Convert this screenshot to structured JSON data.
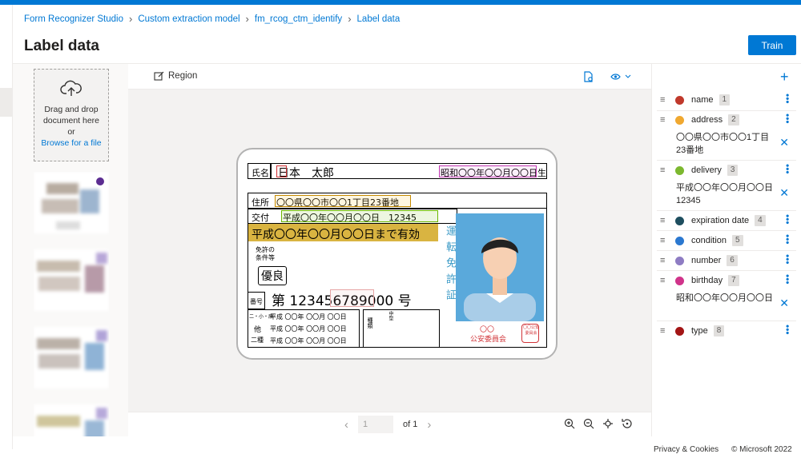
{
  "breadcrumb": [
    "Form Recognizer Studio",
    "Custom extraction model",
    "fm_rcog_ctm_identify",
    "Label data"
  ],
  "page_title": "Label data",
  "train_label": "Train",
  "upload": {
    "line1": "Drag and drop",
    "line2": "document here",
    "line3": "or",
    "browse": "Browse for a file"
  },
  "toolbar": {
    "region_label": "Region"
  },
  "pager": {
    "current": "1",
    "of_label": "of 1"
  },
  "footer": {
    "privacy": "Privacy & Cookies",
    "copyright": "© Microsoft 2022"
  },
  "fields": [
    {
      "name": "name",
      "index": "1",
      "color": "#c0392b",
      "value": ""
    },
    {
      "name": "address",
      "index": "2",
      "color": "#f0a830",
      "value": "〇〇県〇〇市〇〇1丁目23番地"
    },
    {
      "name": "delivery",
      "index": "3",
      "color": "#7cb82f",
      "value": "平成〇〇年〇〇月〇〇日12345"
    },
    {
      "name": "expiration date",
      "index": "4",
      "color": "#1e4e5f",
      "value": ""
    },
    {
      "name": "condition",
      "index": "5",
      "color": "#2b78d0",
      "value": ""
    },
    {
      "name": "number",
      "index": "6",
      "color": "#8e7cc3",
      "value": ""
    },
    {
      "name": "birthday",
      "index": "7",
      "color": "#d0338a",
      "value": "昭和〇〇年〇〇月〇〇日"
    },
    {
      "name": "type",
      "index": "8",
      "color": "#a31515",
      "value": ""
    }
  ],
  "card": {
    "name_label": "氏名",
    "name_value": "日本　太郎",
    "birth_text": "昭和〇〇年〇〇月〇〇日生",
    "address_label": "住所",
    "address_value": "〇〇県〇〇市〇〇1丁目23番地",
    "issue_label": "交付",
    "issue_value": "平成〇〇年〇〇月〇〇日　12345",
    "expiry_text": "平成〇〇年〇〇月〇〇日まで有効",
    "license_cond_1": "免許の",
    "license_cond_2": "条件等",
    "excellent": "優良",
    "number_label": "番号",
    "number_value": "第 123456789000 号",
    "side_text": "運転免許証",
    "cat_rows": [
      "二・小・原",
      "他",
      "二種"
    ],
    "cat_dates": [
      "平成 〇〇年 〇〇月 〇〇日",
      "平成 〇〇年 〇〇月 〇〇日",
      "平成 〇〇年 〇〇月 〇〇日"
    ],
    "kind_label": "種類",
    "chu_label": "中型",
    "issuer_1": "〇〇",
    "issuer_2": "公安委員会",
    "seal_text": "〇〇公安委員会"
  },
  "colors": {
    "accent": "#0078d4",
    "card_gold": "#d9b441",
    "photo_bg": "#5aa9db"
  }
}
